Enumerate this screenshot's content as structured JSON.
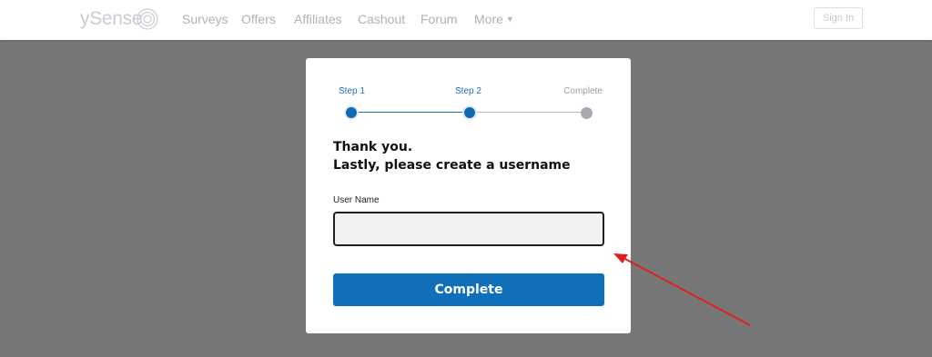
{
  "nav": {
    "logo_text": "ySense",
    "links": [
      "Surveys",
      "Offers",
      "Affiliates",
      "Cashout",
      "Forum",
      "More"
    ],
    "signin_label": "Sign In"
  },
  "modal": {
    "steps": [
      "Step 1",
      "Step 2",
      "Complete"
    ],
    "heading_line1": "Thank you.",
    "heading_line2": "Lastly, please create a username",
    "field_label": "User Name",
    "username_value": "",
    "submit_label": "Complete"
  },
  "colors": {
    "accent": "#0f6fb8",
    "overlay": "#777777",
    "arrow": "#e02020"
  },
  "icons": {
    "more_caret": "caret-down-icon",
    "logo": "swirl-logo-icon"
  }
}
